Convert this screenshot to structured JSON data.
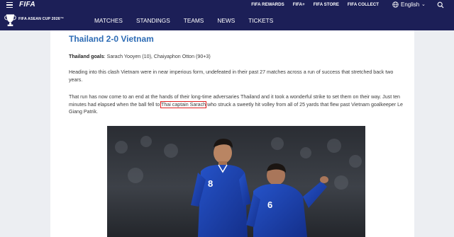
{
  "topbar": {
    "logo": "FIFA",
    "links": [
      "FIFA REWARDS",
      "FIFA+",
      "FIFA STORE",
      "FIFA COLLECT"
    ],
    "language": "English"
  },
  "nav": {
    "event_logo_text": "FIFA ASEAN CUP 2026™",
    "items": [
      "MATCHES",
      "STANDINGS",
      "TEAMS",
      "NEWS",
      "TICKETS"
    ]
  },
  "article": {
    "title": "Thailand 2-0 Vietnam",
    "goals_label": "Thailand goals",
    "goals_text": ": Sarach Yooyen (10), Chaiyaphon Otton (90+3)",
    "para2": "Heading into this clash Vietnam were in near imperious form, undefeated in their past 27 matches across a run of success that stretched back two years.",
    "para3_before": "That run has now come to an end at the hands of their long-time adversaries Thailand and it took a wonderful strike to set them on their way. Just ten minutes had elapsed when the ball fell to ",
    "para3_highlight": "Thai captain Sarach",
    "para3_after": " who struck a sweetly hit volley from all of 25 yards that flew past Vietnam goalkeeper Le Giang Patrik.",
    "player_numbers": [
      "8",
      "6"
    ]
  },
  "colors": {
    "nav_bg": "#1c1f57",
    "title": "#2d6cb5",
    "highlight_border": "#e02020",
    "kit": "#1a3fae"
  }
}
